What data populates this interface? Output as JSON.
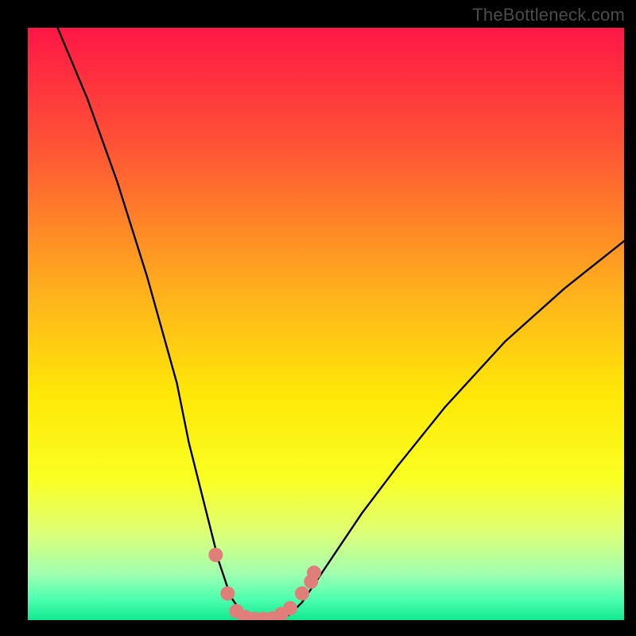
{
  "watermark": {
    "text": "TheBottleneck.com"
  },
  "chart_data": {
    "type": "line",
    "title": "",
    "xlabel": "",
    "ylabel": "",
    "ylim": [
      0,
      100
    ],
    "xlim": [
      0,
      100
    ],
    "series": [
      {
        "name": "bottleneck-curve",
        "x": [
          5,
          10,
          15,
          20,
          25,
          27,
          30,
          32,
          34,
          36,
          38,
          40,
          42,
          44,
          46,
          48,
          52,
          56,
          62,
          70,
          80,
          90,
          100
        ],
        "values": [
          100,
          88,
          74,
          58,
          40,
          30,
          18,
          10,
          4,
          1,
          0,
          0,
          0,
          1,
          3,
          6,
          12,
          18,
          26,
          36,
          47,
          56,
          64
        ]
      }
    ],
    "markers": {
      "name": "highlight-dots",
      "color": "#e07f7a",
      "points": [
        {
          "x": 31.5,
          "y": 11
        },
        {
          "x": 33.5,
          "y": 4.5
        },
        {
          "x": 35.0,
          "y": 1.5
        },
        {
          "x": 36.5,
          "y": 0.5
        },
        {
          "x": 38.0,
          "y": 0.2
        },
        {
          "x": 39.5,
          "y": 0.2
        },
        {
          "x": 41.0,
          "y": 0.3
        },
        {
          "x": 42.5,
          "y": 1.0
        },
        {
          "x": 44.0,
          "y": 2.0
        },
        {
          "x": 46.0,
          "y": 4.5
        },
        {
          "x": 47.5,
          "y": 6.5
        },
        {
          "x": 48.0,
          "y": 8.0
        }
      ]
    },
    "background_gradient": {
      "stops": [
        {
          "offset": 0.0,
          "color": "#ff1746"
        },
        {
          "offset": 0.2,
          "color": "#ff5335"
        },
        {
          "offset": 0.45,
          "color": "#ffb21c"
        },
        {
          "offset": 0.62,
          "color": "#ffe808"
        },
        {
          "offset": 0.76,
          "color": "#faff22"
        },
        {
          "offset": 0.85,
          "color": "#e0ff74"
        },
        {
          "offset": 0.92,
          "color": "#a3ffb0"
        },
        {
          "offset": 0.965,
          "color": "#4dffb0"
        },
        {
          "offset": 1.0,
          "color": "#10e88f"
        }
      ]
    }
  }
}
